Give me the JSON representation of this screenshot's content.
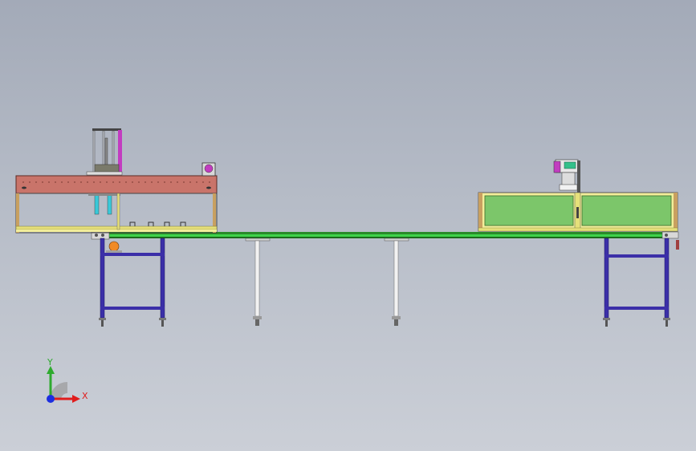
{
  "viewport": {
    "background_top": "#a3aab8",
    "background_bottom": "#cbcfd7"
  },
  "triad": {
    "y_label": "Y",
    "x_label": "X",
    "y_color": "#2eaa2e",
    "x_color": "#e01c1c",
    "z_color": "#1c2ee0"
  },
  "palette": {
    "frame_blue": "#3b2fa8",
    "conveyor_green": "#3fd24a",
    "upper_beam_red": "#c9746a",
    "panel_green": "#7cc66a",
    "panel_yellow": "#e6e07a",
    "magenta_part": "#c23cc0",
    "orange_motor": "#f08a26",
    "leg_white": "#f2f2f2"
  }
}
